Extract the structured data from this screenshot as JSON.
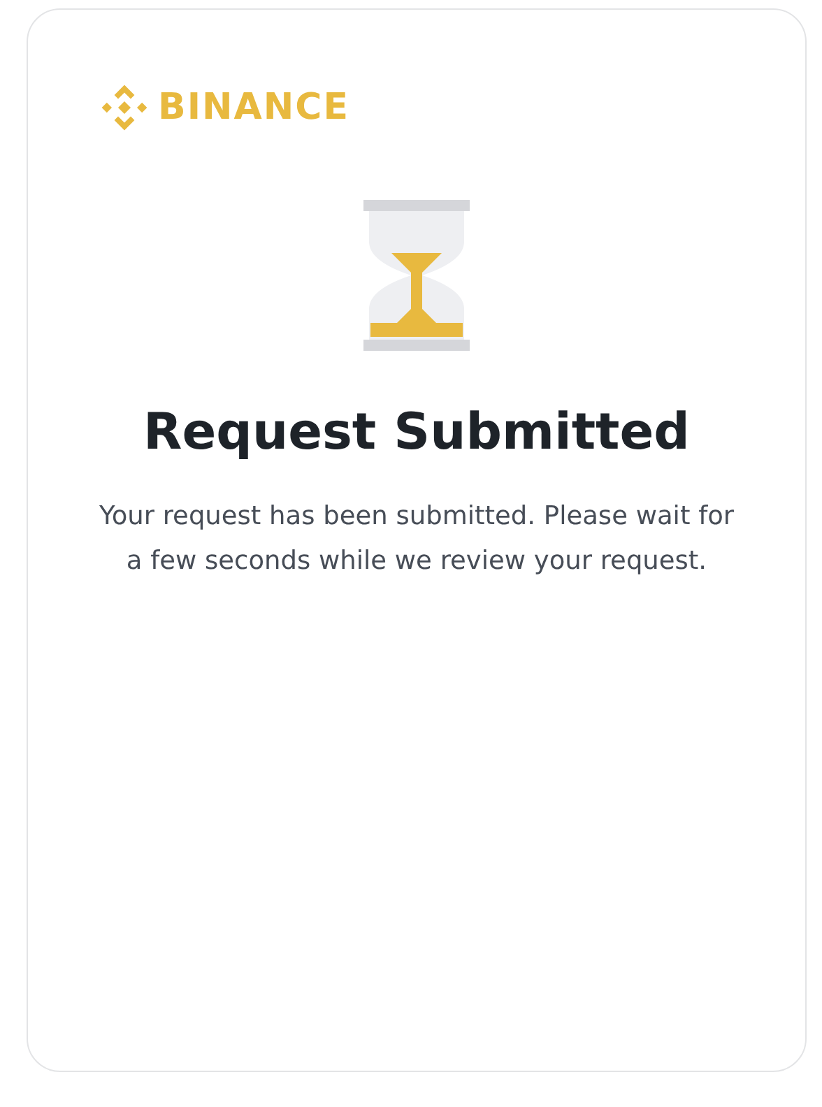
{
  "logo": {
    "text": "BINANCE"
  },
  "title": "Request Submitted",
  "message": "Your request has been submitted. Please wait for a few seconds while we review your request."
}
